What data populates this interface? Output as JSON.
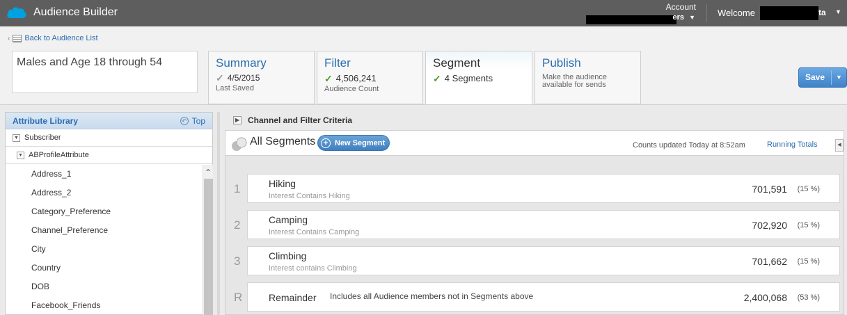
{
  "header": {
    "app_title": "Audience Builder",
    "account_label": "Account",
    "account_value_visible": "ers",
    "welcome_label": "Welcome",
    "welcome_value_visible": "ta",
    "brand_color": "#00a1e0"
  },
  "nav": {
    "back_label": "Back to Audience List"
  },
  "audience": {
    "name": "Males and Age 18 through 54"
  },
  "steps": [
    {
      "title": "Summary",
      "value": "4/5/2015",
      "sub": "Last Saved",
      "check": "grey"
    },
    {
      "title": "Filter",
      "value": "4,506,241",
      "sub": "Audience Count",
      "check": "green"
    },
    {
      "title": "Segment",
      "value": "4 Segments",
      "check": "green",
      "active": true
    },
    {
      "title": "Publish",
      "desc_line1": "Make the audience",
      "desc_line2": "available for sends"
    }
  ],
  "toolbar": {
    "save_label": "Save"
  },
  "library": {
    "title": "Attribute Library",
    "top_label": "Top",
    "tree": [
      "Subscriber",
      "ABProfileAttribute"
    ],
    "attributes": [
      "Address_1",
      "Address_2",
      "Category_Preference",
      "Channel_Preference",
      "City",
      "Country",
      "DOB",
      "Facebook_Friends"
    ]
  },
  "criteria": {
    "label": "Channel and Filter Criteria"
  },
  "segments_panel": {
    "title": "All Segments",
    "new_segment_label": "New Segment",
    "counts_updated": "Counts updated Today at 8:52am",
    "running_totals": "Running Totals",
    "rows": [
      {
        "num": "1",
        "name": "Hiking",
        "desc": "Interest Contains Hiking",
        "count": "701,591",
        "pct": "(15 %)"
      },
      {
        "num": "2",
        "name": "Camping",
        "desc": "Interest Contains Camping",
        "count": "702,920",
        "pct": "(15 %)"
      },
      {
        "num": "3",
        "name": "Climbing",
        "desc": "Interest contains  Climbing",
        "count": "701,662",
        "pct": "(15 %)"
      }
    ],
    "remainder": {
      "num": "R",
      "name": "Remainder",
      "desc": "Includes all Audience members not in Segments above",
      "count": "2,400,068",
      "pct": "(53 %)"
    }
  }
}
